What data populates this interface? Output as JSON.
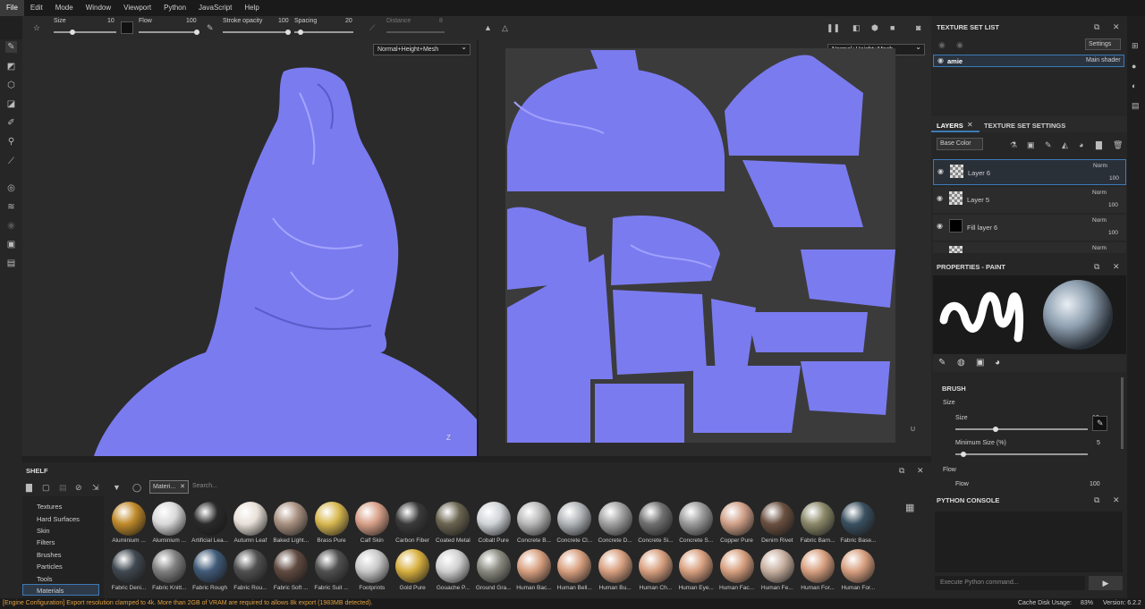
{
  "menu": [
    "File",
    "Edit",
    "Mode",
    "Window",
    "Viewport",
    "Python",
    "JavaScript",
    "Help"
  ],
  "toolbar": {
    "size_label": "Size",
    "size_value": "10",
    "flow_label": "Flow",
    "flow_value": "100",
    "stroke_label": "Stroke opacity",
    "stroke_value": "100",
    "spacing_label": "Spacing",
    "spacing_value": "20",
    "distance_label": "Distance",
    "distance_value": "8"
  },
  "viewport": {
    "mode_left": "Normal+Height+Mesh",
    "mode_right": "Normal+Height+Mesh",
    "axis_z": "Z",
    "axis_u": "U"
  },
  "texture_set_list": {
    "title": "TEXTURE SET LIST",
    "settings": "Settings",
    "item_name": "amie",
    "item_shader": "Main shader"
  },
  "layers": {
    "tab_layers": "LAYERS",
    "tab_settings": "TEXTURE SET SETTINGS",
    "channel": "Base Color",
    "items": [
      {
        "name": "Layer 6",
        "blend": "Norm",
        "opacity": "100"
      },
      {
        "name": "Layer 5",
        "blend": "Norm",
        "opacity": "100"
      },
      {
        "name": "Fill layer 6",
        "blend": "Norm",
        "opacity": "100"
      },
      {
        "name": "",
        "blend": "Norm",
        "opacity": ""
      }
    ]
  },
  "properties": {
    "title": "PROPERTIES - PAINT",
    "brush_title": "BRUSH",
    "size_section": "Size",
    "size_label": "Size",
    "size_value": "10",
    "min_size_label": "Minimum Size (%)",
    "min_size_value": "5",
    "flow_section": "Flow",
    "flow_label": "Flow",
    "flow_value": "100"
  },
  "python": {
    "title": "PYTHON CONSOLE",
    "placeholder": "Execute Python command..."
  },
  "shelf": {
    "title": "SHELF",
    "filter_tag": "Materi...",
    "search_placeholder": "Search...",
    "categories": [
      "Textures",
      "Hard Surfaces",
      "Skin",
      "Filters",
      "Brushes",
      "Particles",
      "Tools",
      "Materials"
    ],
    "row1": [
      {
        "name": "Aluminium ...",
        "color": "#c08a2a"
      },
      {
        "name": "Aluminium ...",
        "color": "#d9d9d9"
      },
      {
        "name": "Artificial Lea...",
        "color": "#2a2a2a"
      },
      {
        "name": "Autumn Leaf",
        "color": "#e8e0d8"
      },
      {
        "name": "Baked Light...",
        "color": "#a89080"
      },
      {
        "name": "Brass Pure",
        "color": "#d8b850"
      },
      {
        "name": "Calf Skin",
        "color": "#d8a088"
      },
      {
        "name": "Carbon Fiber",
        "color": "#3a3a3a"
      },
      {
        "name": "Coated Metal",
        "color": "#6a6450"
      },
      {
        "name": "Cobalt Pure",
        "color": "#d0d4d8"
      },
      {
        "name": "Concrete B...",
        "color": "#b8b8b8"
      },
      {
        "name": "Concrete Cl...",
        "color": "#b0b4b8"
      },
      {
        "name": "Concrete D...",
        "color": "#a0a0a0"
      },
      {
        "name": "Concrete Si...",
        "color": "#707070"
      },
      {
        "name": "Concrete S...",
        "color": "#9a9a9a"
      },
      {
        "name": "Copper Pure",
        "color": "#d0a088"
      },
      {
        "name": "Denim Rivet",
        "color": "#6a5040"
      },
      {
        "name": "Fabric Barn...",
        "color": "#8a8868"
      },
      {
        "name": "Fabric Base...",
        "color": "#3a5060"
      }
    ],
    "row2": [
      {
        "name": "Fabric Deni...",
        "color": "#404850"
      },
      {
        "name": "Fabric Knitt...",
        "color": "#808080"
      },
      {
        "name": "Fabric Rough",
        "color": "#405a78"
      },
      {
        "name": "Fabric Rou...",
        "color": "#505050"
      },
      {
        "name": "Fabric Soft ...",
        "color": "#604a40"
      },
      {
        "name": "Fabric Suit ...",
        "color": "#505050"
      },
      {
        "name": "Footprints",
        "color": "#c8c8c8"
      },
      {
        "name": "Gold Pure",
        "color": "#d8b040"
      },
      {
        "name": "Gouache P...",
        "color": "#d0d0d0"
      },
      {
        "name": "Ground Gra...",
        "color": "#8a8a80"
      },
      {
        "name": "Human Bac...",
        "color": "#d8a080"
      },
      {
        "name": "Human Bell...",
        "color": "#d8a080"
      },
      {
        "name": "Human Bu...",
        "color": "#d8a080"
      },
      {
        "name": "Human Ch...",
        "color": "#d8a080"
      },
      {
        "name": "Human Eye...",
        "color": "#d8a080"
      },
      {
        "name": "Human Fac...",
        "color": "#d8a080"
      },
      {
        "name": "Human Fe...",
        "color": "#c8b0a0"
      },
      {
        "name": "Human For...",
        "color": "#d8a080"
      },
      {
        "name": "Human For...",
        "color": "#d8a080"
      }
    ]
  },
  "status": {
    "message": "[Engine Configuration] Export resolution clamped to 4k. More than 2GB of VRAM are required to allows 8k export (1983MB detected).",
    "disk_label": "Cache Disk Usage:",
    "disk_value": "83%",
    "version": "Version: 6.2.2"
  },
  "colors": {
    "normal_map": "#7b7bf0",
    "accent": "#3d7ab8",
    "warning": "#e0a040"
  }
}
